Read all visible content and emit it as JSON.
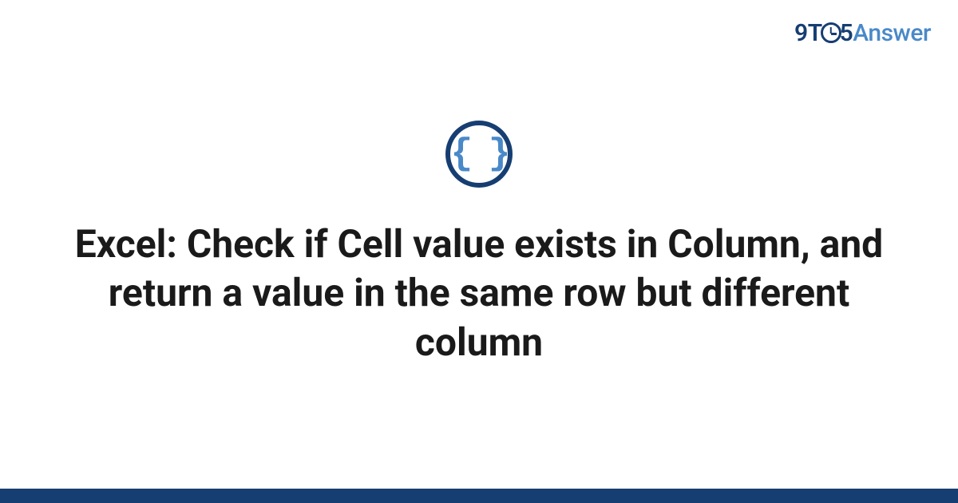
{
  "brand": {
    "part1": "9",
    "part2": "T",
    "part3": "5",
    "part4": "Answer"
  },
  "icon": {
    "braces": "{ }"
  },
  "title": "Excel: Check if Cell value exists in Column, and return a value in the same row but different column",
  "colors": {
    "primary": "#163e72",
    "accent": "#4a89c8"
  }
}
